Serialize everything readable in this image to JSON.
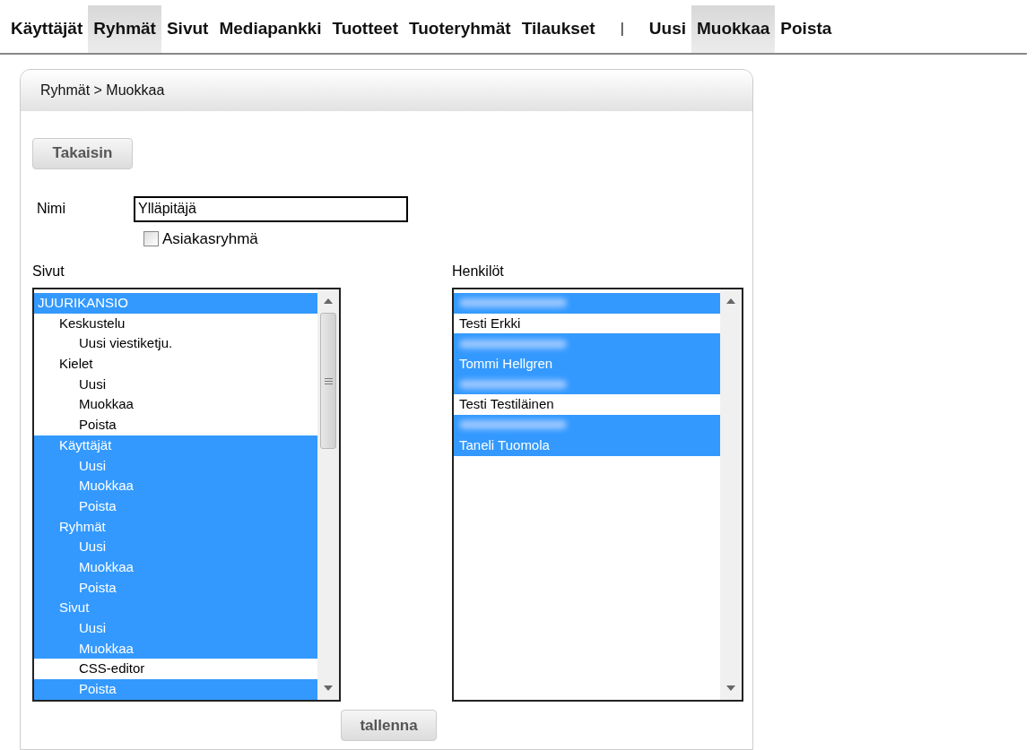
{
  "nav": {
    "items": [
      {
        "label": "Käyttäjät",
        "selected": false
      },
      {
        "label": "Ryhmät",
        "selected": true
      },
      {
        "label": "Sivut",
        "selected": false
      },
      {
        "label": "Mediapankki",
        "selected": false
      },
      {
        "label": "Tuotteet",
        "selected": false
      },
      {
        "label": "Tuoteryhmät",
        "selected": false
      },
      {
        "label": "Tilaukset",
        "selected": false
      }
    ],
    "separator": "|",
    "actions": [
      {
        "label": "Uusi",
        "selected": false
      },
      {
        "label": "Muokkaa",
        "selected": true
      },
      {
        "label": "Poista",
        "selected": false
      }
    ]
  },
  "panel": {
    "breadcrumb": "Ryhmät > Muokkaa",
    "back_button": "Takaisin",
    "name_field": {
      "label": "Nimi",
      "value": "Ylläpitäjä"
    },
    "customer_group": {
      "label": "Asiakasryhmä",
      "checked": false
    },
    "pages": {
      "label": "Sivut",
      "items": [
        {
          "label": "JUURIKANSIO",
          "selected": true,
          "children": [
            {
              "label": "Keskustelu",
              "selected": false,
              "children": [
                {
                  "label": "Uusi viestiketju.",
                  "selected": false
                }
              ]
            },
            {
              "label": "Kielet",
              "selected": false,
              "children": [
                {
                  "label": "Uusi",
                  "selected": false
                },
                {
                  "label": "Muokkaa",
                  "selected": false
                },
                {
                  "label": "Poista",
                  "selected": false
                }
              ]
            },
            {
              "label": "Käyttäjät",
              "selected": true,
              "children": [
                {
                  "label": "Uusi",
                  "selected": true
                },
                {
                  "label": "Muokkaa",
                  "selected": true
                },
                {
                  "label": "Poista",
                  "selected": true
                }
              ]
            },
            {
              "label": "Ryhmät",
              "selected": true,
              "children": [
                {
                  "label": "Uusi",
                  "selected": true
                },
                {
                  "label": "Muokkaa",
                  "selected": true
                },
                {
                  "label": "Poista",
                  "selected": true
                }
              ]
            },
            {
              "label": "Sivut",
              "selected": true,
              "children": [
                {
                  "label": "Uusi",
                  "selected": true
                },
                {
                  "label": "Muokkaa",
                  "selected": true
                },
                {
                  "label": "CSS-editor",
                  "selected": false
                },
                {
                  "label": "Poista",
                  "selected": true
                }
              ]
            }
          ]
        }
      ]
    },
    "people": {
      "label": "Henkilöt",
      "items": [
        {
          "kind": "blurred",
          "selected": true
        },
        {
          "kind": "name",
          "label": "Testi Erkki",
          "selected": false
        },
        {
          "kind": "blurred",
          "selected": true
        },
        {
          "kind": "name",
          "label": "Tommi Hellgren",
          "selected": true
        },
        {
          "kind": "blurred",
          "selected": true
        },
        {
          "kind": "name",
          "label": "Testi Testiläinen",
          "selected": false
        },
        {
          "kind": "blurred",
          "selected": true
        },
        {
          "kind": "name",
          "label": "Taneli Tuomola",
          "selected": true
        }
      ]
    },
    "save_button": "tallenna"
  }
}
